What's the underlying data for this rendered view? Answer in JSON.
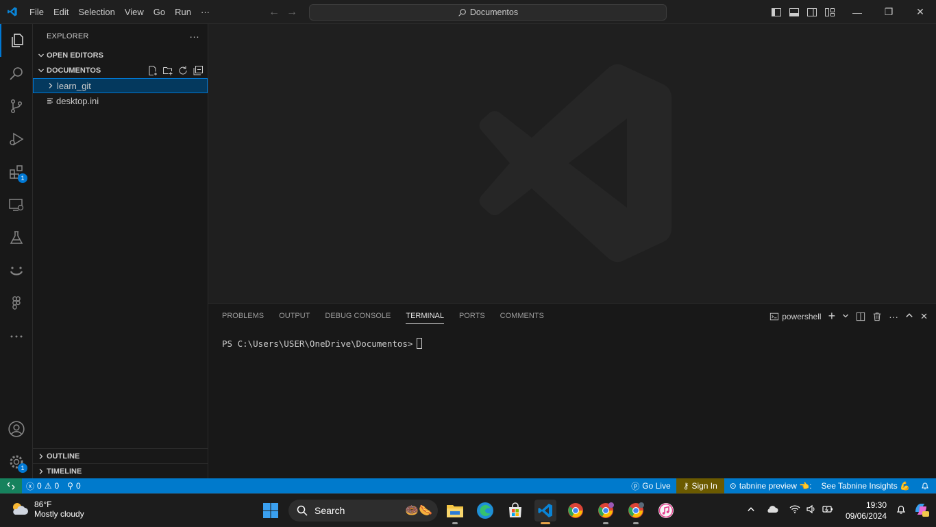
{
  "titlebar": {
    "menu": [
      "File",
      "Edit",
      "Selection",
      "View",
      "Go",
      "Run",
      "···"
    ],
    "search_label": "Documentos"
  },
  "activitybar": {
    "extensions_badge": "1",
    "manage_badge": "1"
  },
  "sidebar": {
    "header": "EXPLORER",
    "more": "···",
    "open_editors": "OPEN EDITORS",
    "folder": "DOCUMENTOS",
    "items": [
      {
        "label": "learn_git",
        "type": "folder"
      },
      {
        "label": "desktop.ini",
        "type": "file"
      }
    ],
    "outline": "OUTLINE",
    "timeline": "TIMELINE"
  },
  "panel": {
    "tabs": [
      "PROBLEMS",
      "OUTPUT",
      "DEBUG CONSOLE",
      "TERMINAL",
      "PORTS",
      "COMMENTS"
    ],
    "active_tab": "TERMINAL",
    "shell": "powershell",
    "prompt": "PS C:\\Users\\USER\\OneDrive\\Documentos>"
  },
  "statusbar": {
    "errors": "0",
    "warnings": "0",
    "ports": "0",
    "go_live": "Go Live",
    "sign_in": "Sign In",
    "tabnine": "tabnine preview 👈:",
    "insights": "See Tabnine Insights 💪"
  },
  "taskbar": {
    "temperature": "86°F",
    "weather": "Mostly cloudy",
    "search_label": "Search",
    "time": "19:30",
    "date": "09/06/2024"
  },
  "colors": {
    "accent": "#0078d4",
    "statusbar": "#007acc",
    "remote": "#16825d"
  }
}
